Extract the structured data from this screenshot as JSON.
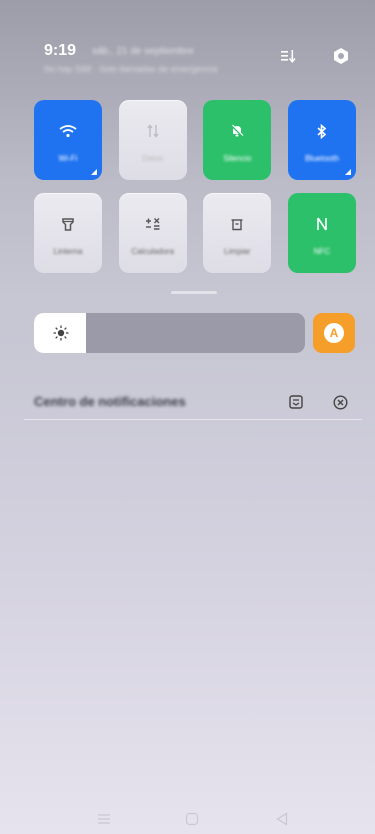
{
  "status_bar": {
    "time": "9:19",
    "date": "sáb., 21 de septiembre",
    "carrier_info": "No hay SIM · Solo llamadas de emergencia"
  },
  "header_icons": [
    "edit-tiles-icon",
    "settings-icon"
  ],
  "tiles": [
    {
      "name": "wifi",
      "label": "Wi-Fi",
      "icon": "wifi-icon",
      "state": "on",
      "color": "#1f73f0"
    },
    {
      "name": "mobile-data",
      "label": "Datos",
      "icon": "data-arrows-icon",
      "state": "disabled",
      "color": "#e6e5ec"
    },
    {
      "name": "silent",
      "label": "Silencio",
      "icon": "bell-off-icon",
      "state": "on",
      "color": "#2cc06a"
    },
    {
      "name": "bluetooth",
      "label": "Bluetooth",
      "icon": "bluetooth-icon",
      "state": "on",
      "color": "#1f73f0"
    },
    {
      "name": "flashlight",
      "label": "Linterna",
      "icon": "flashlight-icon",
      "state": "off",
      "color": "#e6e5ec"
    },
    {
      "name": "calculator",
      "label": "Calculadora",
      "icon": "calculator-icon",
      "state": "off",
      "color": "#e6e5ec"
    },
    {
      "name": "clean",
      "label": "Limpiar",
      "icon": "trash-icon",
      "state": "off",
      "color": "#e6e5ec"
    },
    {
      "name": "nfc",
      "label": "NFC",
      "icon": "nfc-icon",
      "state": "on",
      "color": "#2cc06a"
    }
  ],
  "brightness": {
    "level": 0.2,
    "auto_label": "A",
    "icon": "sun-icon"
  },
  "notifications": {
    "title": "Centro de notificaciones",
    "icons": [
      "manage-notifications-icon",
      "clear-all-icon"
    ]
  },
  "navigation": [
    "menu-icon",
    "home-icon",
    "back-icon"
  ]
}
